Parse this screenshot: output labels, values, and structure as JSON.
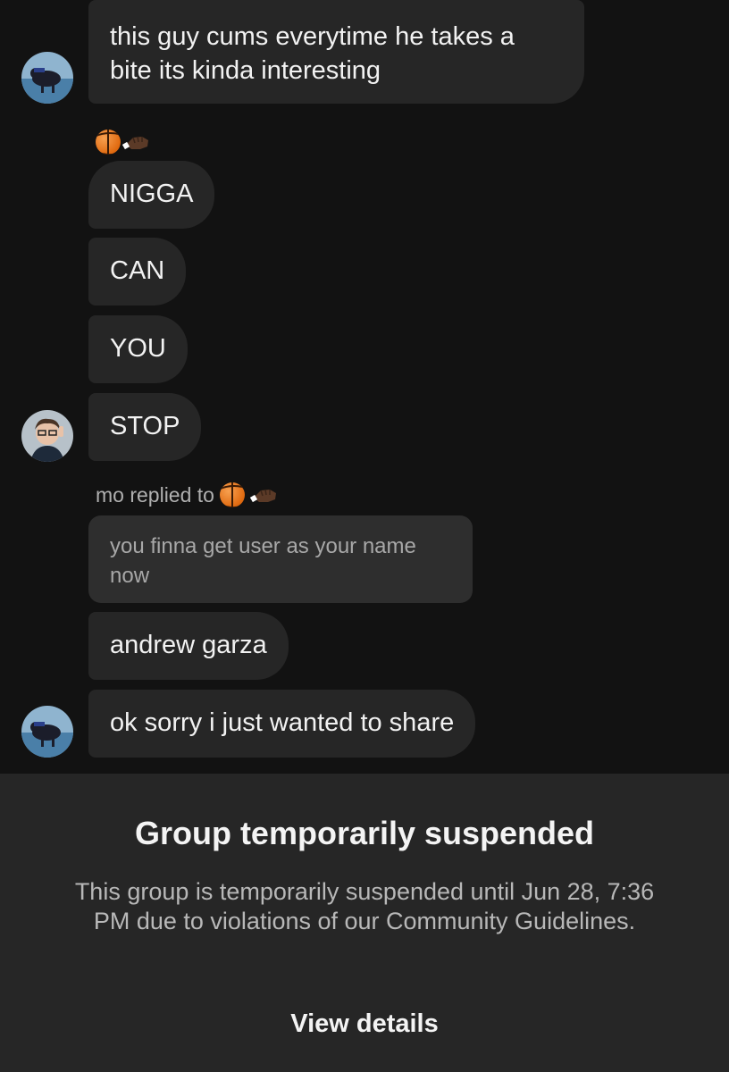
{
  "messages": [
    {
      "id": "m1",
      "text": "this guy cums everytime he takes a bite its kinda interesting"
    },
    {
      "id": "m2",
      "text": "NIGGA"
    },
    {
      "id": "m3",
      "text": "CAN"
    },
    {
      "id": "m4",
      "text": "YOU"
    },
    {
      "id": "m5",
      "text": "STOP"
    },
    {
      "id": "m6",
      "text": "andrew garza"
    },
    {
      "id": "m7",
      "text": "ok sorry i just wanted to share"
    }
  ],
  "reply": {
    "label": "mo replied to",
    "quoted_text": "you finna get user as your name now"
  },
  "icons": {
    "sender_icons": [
      "basketball-icon",
      "fist-icon"
    ]
  },
  "banner": {
    "title": "Group temporarily suspended",
    "body": "This group is temporarily suspended until Jun 28, 7:36 PM due to violations of our Community Guidelines.",
    "link": "View details"
  },
  "colors": {
    "background": "#121212",
    "bubble": "#262626",
    "banner": "#262626"
  }
}
